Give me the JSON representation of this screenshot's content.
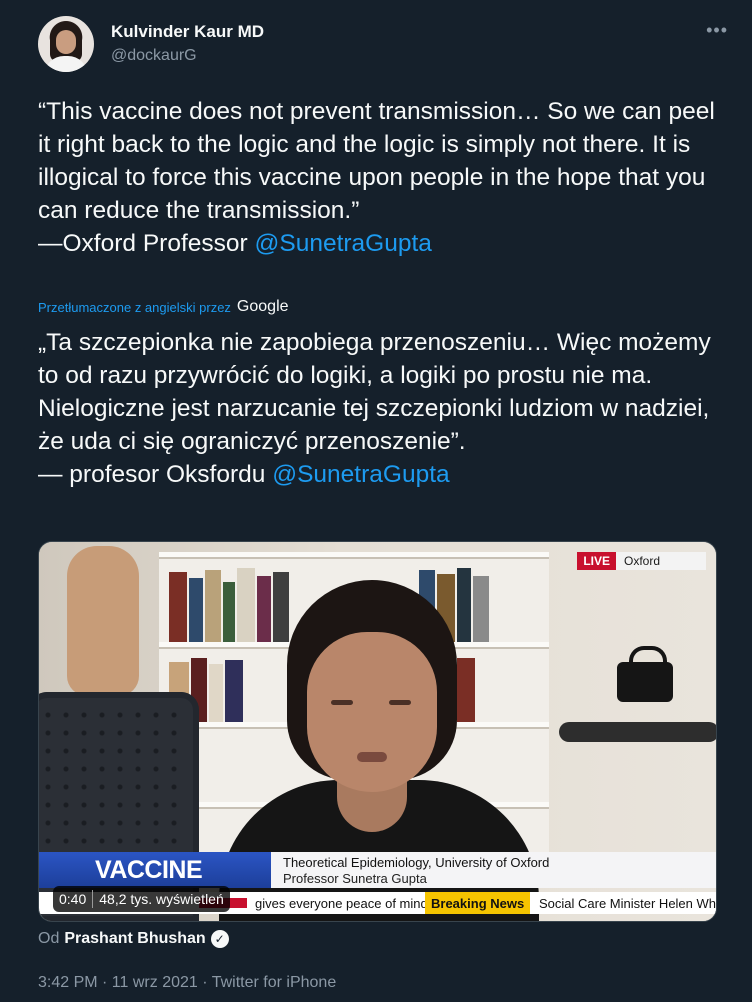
{
  "author": {
    "name": "Kulvinder Kaur MD",
    "handle": "@dockaurG",
    "more_icon": "more-horizontal-icon"
  },
  "tweet": {
    "text": "“This vaccine does not prevent transmission… So we can peel it right back to the logic and the logic is simply not there. It is illogical to force this vaccine upon people in the hope that you can reduce the transmission.”",
    "attribution_prefix": "—Oxford Professor ",
    "attribution_mention": "@SunetraGupta"
  },
  "translation": {
    "label": "Przetłumaczone z angielski przez",
    "provider": "Google",
    "text": "„Ta szczepionka nie zapobiega przenoszeniu… Więc możemy to od razu przywrócić do logiki, a logiki po prostu nie ma. Nielogiczne jest narzucanie tej szczepionki ludziom w nadziei, że uda ci się ograniczyć przenoszenie”.",
    "attribution_prefix": " — profesor Oksfordu ",
    "attribution_mention": "@SunetraGupta"
  },
  "media": {
    "live_label": "LIVE",
    "location": "Oxford",
    "banner": "VACCINE ROLLOUT",
    "caption_line1": "Theoretical Epidemiology, University of Oxford",
    "caption_line2": "Professor Sunetra Gupta",
    "ticker_text1": "gives everyone peace of mind",
    "ticker_breaking": "Breaking News",
    "ticker_text2": "Social Care Minister Helen Wha",
    "duration": "0:40",
    "views": "48,2 tys. wyświetleń"
  },
  "byline": {
    "prefix": "Od",
    "author": "Prashant Bhushan",
    "verified_icon": "verified-badge-icon"
  },
  "meta": {
    "timestamp": "3:42 PM · 11 wrz 2021 · Twitter for iPhone"
  },
  "colors": {
    "background": "#15202b",
    "accent": "#1d9bf0",
    "muted": "#8b98a5"
  }
}
